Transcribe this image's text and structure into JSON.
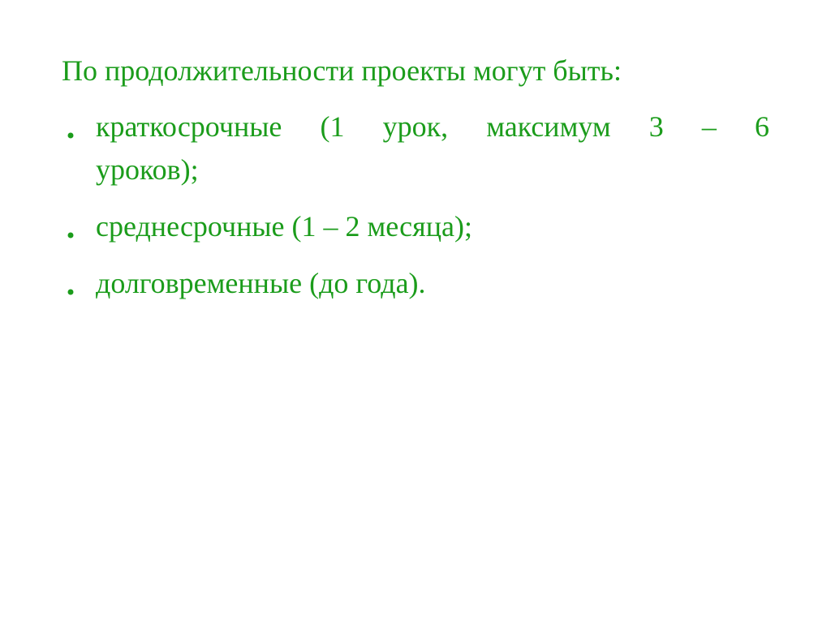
{
  "heading": "По продолжительности проекты могут быть:",
  "items": [
    {
      "line1": "краткосрочные (1 урок, максимум 3 – 6",
      "line2": "уроков);"
    },
    {
      "line1": "среднесрочные (1 – 2 месяца);",
      "line2": ""
    },
    {
      "line1": "долговременные (до года).",
      "line2": ""
    }
  ]
}
